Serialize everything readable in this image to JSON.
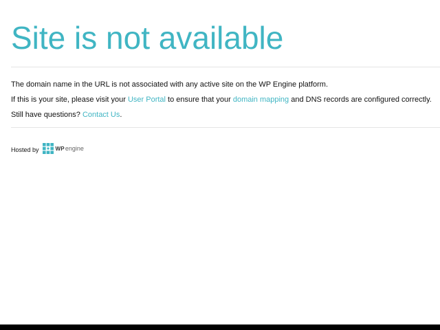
{
  "page": {
    "title": "Site is not available",
    "para1": "The domain name in the URL is not associated with any active site on the WP Engine platform.",
    "para2": {
      "before": "If this is your site, please visit your ",
      "link1": "User Portal",
      "middle": " to ensure that your ",
      "link2": "domain mapping",
      "after": " and DNS records are configured correctly."
    },
    "para3": {
      "before": "Still have questions? ",
      "link": "Contact Us",
      "after": "."
    }
  },
  "footer": {
    "hosted_by": "Hosted by",
    "logo_wp": "WP",
    "logo_engine": "engine"
  },
  "colors": {
    "accent": "#40b5c3",
    "text": "#111111",
    "rule": "#e4e4e4",
    "bottom_bar": "#000000"
  },
  "icons": {
    "logo": "wp-engine-logo-icon"
  }
}
